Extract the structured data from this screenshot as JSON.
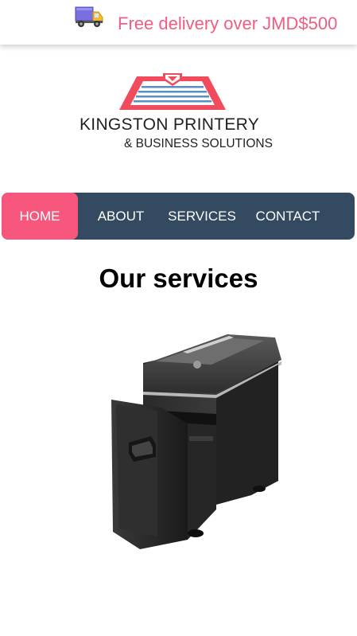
{
  "banner": {
    "icon": "delivery-truck-icon",
    "text": "Free delivery over JMD$500",
    "text_color": "#f05d82"
  },
  "logo": {
    "title": "KINGSTON PRINTERY",
    "subtitle": "& BUSINESS SOLUTIONS",
    "accent_color": "#f14b5e",
    "stripe_color": "#5b8fc2"
  },
  "nav": {
    "items": [
      {
        "label": "HOME",
        "active": true
      },
      {
        "label": "ABOUT",
        "active": false
      },
      {
        "label": "SERVICES",
        "active": false
      },
      {
        "label": "CONTACT",
        "active": false
      }
    ],
    "background": "#344a60",
    "active_color": "#f7577c"
  },
  "main": {
    "heading": "Our services",
    "image": "paper-shredder"
  }
}
